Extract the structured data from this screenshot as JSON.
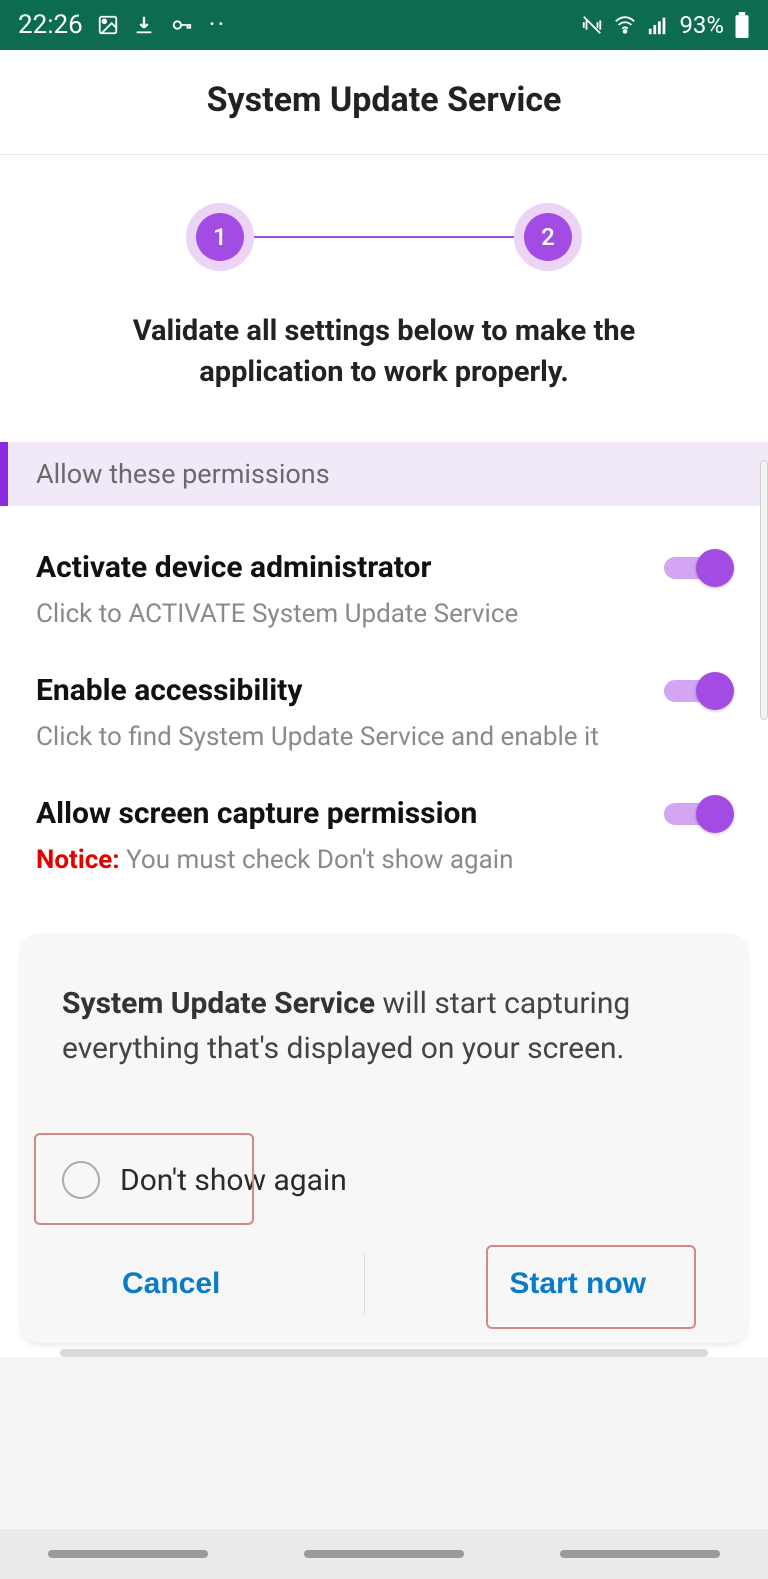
{
  "statusbar": {
    "time": "22:26",
    "battery": "93%"
  },
  "header": {
    "title": "System Update Service"
  },
  "stepper": {
    "step1": "1",
    "step2": "2"
  },
  "subtitle": "Validate all settings below to make the application to work properly.",
  "section": {
    "title": "Allow these permissions"
  },
  "perms": [
    {
      "title": "Activate device administrator",
      "sub": "Click to ACTIVATE System Update Service",
      "on": true
    },
    {
      "title": "Enable accessibility",
      "sub": "Click to find System Update Service and enable it",
      "on": true
    },
    {
      "title": "Allow screen capture permission",
      "notice_label": "Notice:",
      "notice_text": " You must check Don't show again",
      "on": true
    }
  ],
  "dialog": {
    "app_name": "System Update Service",
    "body_rest": " will start capturing everything that's displayed on your screen.",
    "checkbox_label": "Don't show again",
    "cancel": "Cancel",
    "start": "Start now"
  }
}
